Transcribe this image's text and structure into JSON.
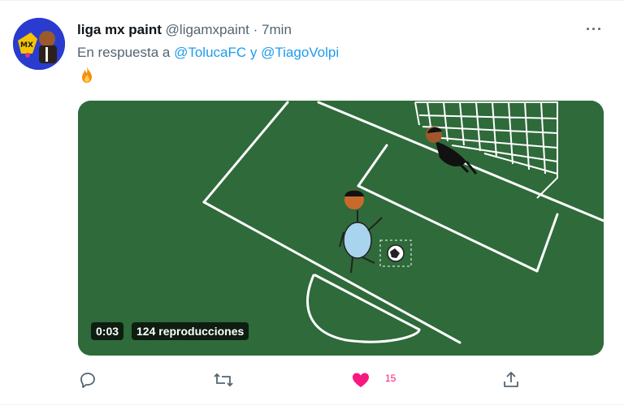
{
  "tweet": {
    "display_name": "liga mx paint",
    "handle": "@ligamxpaint",
    "separator": "·",
    "time": "7min",
    "reply_prefix": "En respuesta a",
    "mention_1": "@TolucaFC",
    "reply_join": "y",
    "mention_2": "@TiagoVolpi",
    "body_emoji": "fire",
    "more_label": "···"
  },
  "video": {
    "duration": "0:03",
    "views": "124 reproducciones"
  },
  "actions": {
    "like_count": "15",
    "like_state": "liked"
  },
  "colors": {
    "pitch_green": "#2f6a3a",
    "link_blue": "#1d9bf0",
    "like_pink": "#f91880",
    "muted_gray": "#536471"
  }
}
